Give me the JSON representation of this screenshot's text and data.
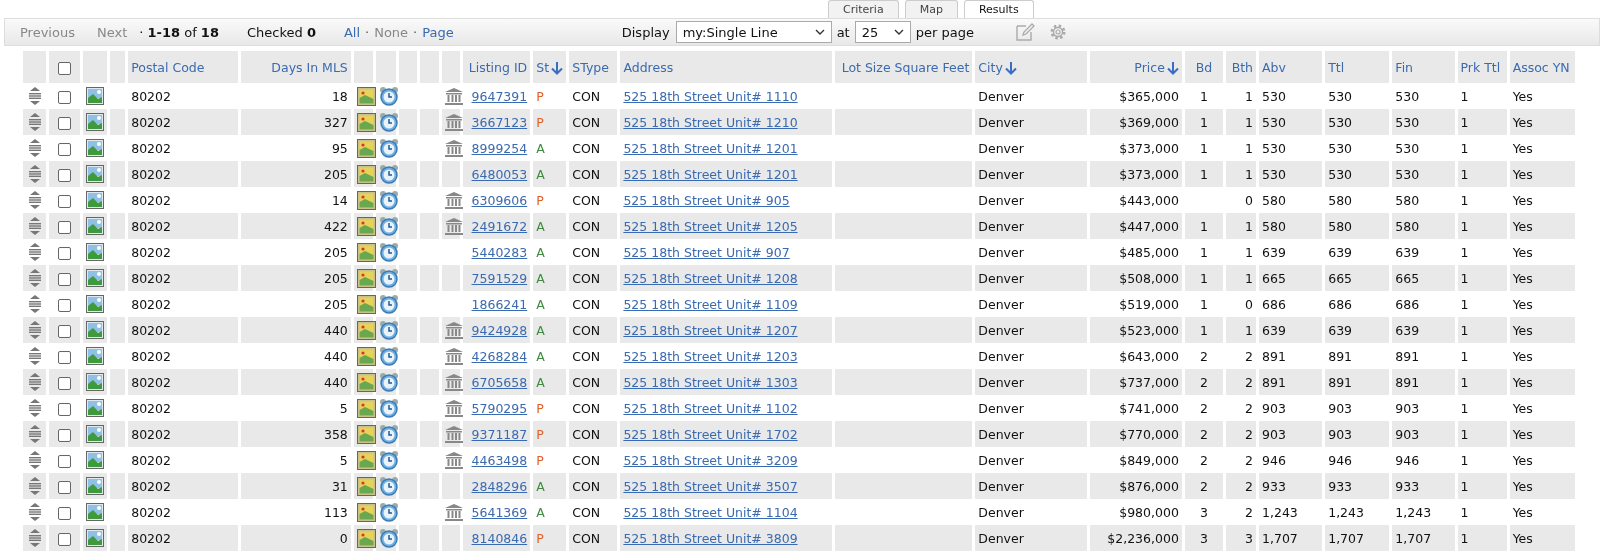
{
  "tabs": [
    {
      "label": "Criteria",
      "selected": false
    },
    {
      "label": "Map",
      "selected": false
    },
    {
      "label": "Results",
      "selected": true
    }
  ],
  "toolbar": {
    "previous": "Previous",
    "next": "Next",
    "range": "· **1-18** of **18**",
    "checked": "Checked **0**",
    "select_links": [
      {
        "label": "All",
        "disabled": false
      },
      {
        "label": "None",
        "disabled": true
      },
      {
        "label": "Page",
        "disabled": false
      }
    ],
    "separator": "·",
    "display_label": "Display",
    "display_value": "my:Single Line",
    "at_label": "at",
    "per_page_value": "25",
    "per_page_label": "per page"
  },
  "table": {
    "select_all_checked": false,
    "columns": [
      {
        "label": "Postal Code",
        "sorted": false
      },
      {
        "label": "Days In MLS",
        "sorted": false
      },
      {
        "label": "Listing ID",
        "sorted": false
      },
      {
        "label": "St",
        "sorted": true
      },
      {
        "label": "SType",
        "sorted": false
      },
      {
        "label": "Address",
        "sorted": false
      },
      {
        "label": "Lot Size Square Feet",
        "sorted": false
      },
      {
        "label": "City",
        "sorted": true
      },
      {
        "label": "Price",
        "sorted": true
      },
      {
        "label": "Bd",
        "sorted": false
      },
      {
        "label": "Bth",
        "sorted": false
      },
      {
        "label": "Abv",
        "sorted": false
      },
      {
        "label": "Ttl",
        "sorted": false
      },
      {
        "label": "Fin",
        "sorted": false
      },
      {
        "label": "Prk Ttl",
        "sorted": false
      },
      {
        "label": "Assoc YN",
        "sorted": false
      }
    ],
    "rows": [
      {
        "checked": false,
        "postal": "80202",
        "days": "18",
        "building_icon": true,
        "listing_id": "9647391",
        "status": "P",
        "color": "#e0602c",
        "stype": "CON",
        "address": "525 18th Street Unit# 1110",
        "city": "Denver",
        "price": "$365,000",
        "bd": "1",
        "bth": "1",
        "abv": "530",
        "ttl": "530",
        "fin": "530",
        "prk": "1",
        "assoc": "Yes"
      },
      {
        "checked": false,
        "postal": "80202",
        "days": "327",
        "building_icon": true,
        "listing_id": "3667123",
        "status": "P",
        "color": "#e0602c",
        "stype": "CON",
        "address": "525 18th Street Unit# 1210",
        "city": "Denver",
        "price": "$369,000",
        "bd": "1",
        "bth": "1",
        "abv": "530",
        "ttl": "530",
        "fin": "530",
        "prk": "1",
        "assoc": "Yes"
      },
      {
        "checked": false,
        "postal": "80202",
        "days": "95",
        "building_icon": true,
        "listing_id": "8999254",
        "status": "A",
        "color": "#3e8a3e",
        "stype": "CON",
        "address": "525 18th Street Unit# 1201",
        "city": "Denver",
        "price": "$373,000",
        "bd": "1",
        "bth": "1",
        "abv": "530",
        "ttl": "530",
        "fin": "530",
        "prk": "1",
        "assoc": "Yes"
      },
      {
        "checked": false,
        "postal": "80202",
        "days": "205",
        "building_icon": false,
        "listing_id": "6480053",
        "status": "A",
        "color": "#3e8a3e",
        "stype": "CON",
        "address": "525 18th Street Unit# 1201",
        "city": "Denver",
        "price": "$373,000",
        "bd": "1",
        "bth": "1",
        "abv": "530",
        "ttl": "530",
        "fin": "530",
        "prk": "1",
        "assoc": "Yes"
      },
      {
        "checked": false,
        "postal": "80202",
        "days": "14",
        "building_icon": true,
        "listing_id": "6309606",
        "status": "P",
        "color": "#e0602c",
        "stype": "CON",
        "address": "525 18th Street Unit# 905",
        "city": "Denver",
        "price": "$443,000",
        "bth": "0",
        "abv": "580",
        "ttl": "580",
        "fin": "580",
        "prk": "1",
        "assoc": "Yes"
      },
      {
        "checked": false,
        "postal": "80202",
        "days": "422",
        "building_icon": true,
        "listing_id": "2491672",
        "status": "A",
        "color": "#3e8a3e",
        "stype": "CON",
        "address": "525 18th Street Unit# 1205",
        "city": "Denver",
        "price": "$447,000",
        "bd": "1",
        "bth": "1",
        "abv": "580",
        "ttl": "580",
        "fin": "580",
        "prk": "1",
        "assoc": "Yes"
      },
      {
        "checked": false,
        "postal": "80202",
        "days": "205",
        "building_icon": false,
        "listing_id": "5440283",
        "status": "A",
        "color": "#3e8a3e",
        "stype": "CON",
        "address": "525 18th Street Unit# 907",
        "city": "Denver",
        "price": "$485,000",
        "bd": "1",
        "bth": "1",
        "abv": "639",
        "ttl": "639",
        "fin": "639",
        "prk": "1",
        "assoc": "Yes"
      },
      {
        "checked": false,
        "postal": "80202",
        "days": "205",
        "building_icon": false,
        "listing_id": "7591529",
        "status": "A",
        "color": "#3e8a3e",
        "stype": "CON",
        "address": "525 18th Street Unit# 1208",
        "city": "Denver",
        "price": "$508,000",
        "bd": "1",
        "bth": "1",
        "abv": "665",
        "ttl": "665",
        "fin": "665",
        "prk": "1",
        "assoc": "Yes"
      },
      {
        "checked": false,
        "postal": "80202",
        "days": "205",
        "building_icon": false,
        "listing_id": "1866241",
        "status": "A",
        "color": "#3e8a3e",
        "stype": "CON",
        "address": "525 18th Street Unit# 1109",
        "city": "Denver",
        "price": "$519,000",
        "bd": "1",
        "bth": "0",
        "abv": "686",
        "ttl": "686",
        "fin": "686",
        "prk": "1",
        "assoc": "Yes"
      },
      {
        "checked": false,
        "postal": "80202",
        "days": "440",
        "building_icon": true,
        "listing_id": "9424928",
        "status": "A",
        "color": "#3e8a3e",
        "stype": "CON",
        "address": "525 18th Street Unit# 1207",
        "city": "Denver",
        "price": "$523,000",
        "bd": "1",
        "bth": "1",
        "abv": "639",
        "ttl": "639",
        "fin": "639",
        "prk": "1",
        "assoc": "Yes"
      },
      {
        "checked": false,
        "postal": "80202",
        "days": "440",
        "building_icon": true,
        "listing_id": "4268284",
        "status": "A",
        "color": "#3e8a3e",
        "stype": "CON",
        "address": "525 18th Street Unit# 1203",
        "city": "Denver",
        "price": "$643,000",
        "bd": "2",
        "bth": "2",
        "abv": "891",
        "ttl": "891",
        "fin": "891",
        "prk": "1",
        "assoc": "Yes"
      },
      {
        "checked": false,
        "postal": "80202",
        "days": "440",
        "building_icon": true,
        "listing_id": "6705658",
        "status": "A",
        "color": "#3e8a3e",
        "stype": "CON",
        "address": "525 18th Street Unit# 1303",
        "city": "Denver",
        "price": "$737,000",
        "bd": "2",
        "bth": "2",
        "abv": "891",
        "ttl": "891",
        "fin": "891",
        "prk": "1",
        "assoc": "Yes"
      },
      {
        "checked": false,
        "postal": "80202",
        "days": "5",
        "building_icon": true,
        "listing_id": "5790295",
        "status": "P",
        "color": "#e0602c",
        "stype": "CON",
        "address": "525 18th Street Unit# 1102",
        "city": "Denver",
        "price": "$741,000",
        "bd": "2",
        "bth": "2",
        "abv": "903",
        "ttl": "903",
        "fin": "903",
        "prk": "1",
        "assoc": "Yes"
      },
      {
        "checked": false,
        "postal": "80202",
        "days": "358",
        "building_icon": true,
        "listing_id": "9371187",
        "status": "P",
        "color": "#e0602c",
        "stype": "CON",
        "address": "525 18th Street Unit# 1702",
        "city": "Denver",
        "price": "$770,000",
        "bd": "2",
        "bth": "2",
        "abv": "903",
        "ttl": "903",
        "fin": "903",
        "prk": "1",
        "assoc": "Yes"
      },
      {
        "checked": false,
        "postal": "80202",
        "days": "5",
        "building_icon": true,
        "listing_id": "4463498",
        "status": "P",
        "color": "#e0602c",
        "stype": "CON",
        "address": "525 18th Street Unit# 3209",
        "city": "Denver",
        "price": "$849,000",
        "bd": "2",
        "bth": "2",
        "abv": "946",
        "ttl": "946",
        "fin": "946",
        "prk": "1",
        "assoc": "Yes"
      },
      {
        "checked": false,
        "postal": "80202",
        "days": "31",
        "building_icon": false,
        "listing_id": "2848296",
        "status": "A",
        "color": "#3e8a3e",
        "stype": "CON",
        "address": "525 18th Street Unit# 3507",
        "city": "Denver",
        "price": "$876,000",
        "bd": "2",
        "bth": "2",
        "abv": "933",
        "ttl": "933",
        "fin": "933",
        "prk": "1",
        "assoc": "Yes"
      },
      {
        "checked": false,
        "postal": "80202",
        "days": "113",
        "building_icon": true,
        "listing_id": "5641369",
        "status": "A",
        "color": "#3e8a3e",
        "stype": "CON",
        "address": "525 18th Street Unit# 1104",
        "city": "Denver",
        "price": "$980,000",
        "bd": "3",
        "bth": "2",
        "abv": "1,243",
        "ttl": "1,243",
        "fin": "1,243",
        "prk": "1",
        "assoc": "Yes"
      },
      {
        "checked": false,
        "postal": "80202",
        "days": "0",
        "building_icon": false,
        "listing_id": "8140846",
        "status": "P",
        "color": "#e0602c",
        "stype": "CON",
        "address": "525 18th Street Unit# 3809",
        "city": "Denver",
        "price": "$2,236,000",
        "bd": "3",
        "bth": "3",
        "abv": "1,707",
        "ttl": "1,707",
        "fin": "1,707",
        "prk": "1",
        "assoc": "Yes"
      }
    ]
  }
}
